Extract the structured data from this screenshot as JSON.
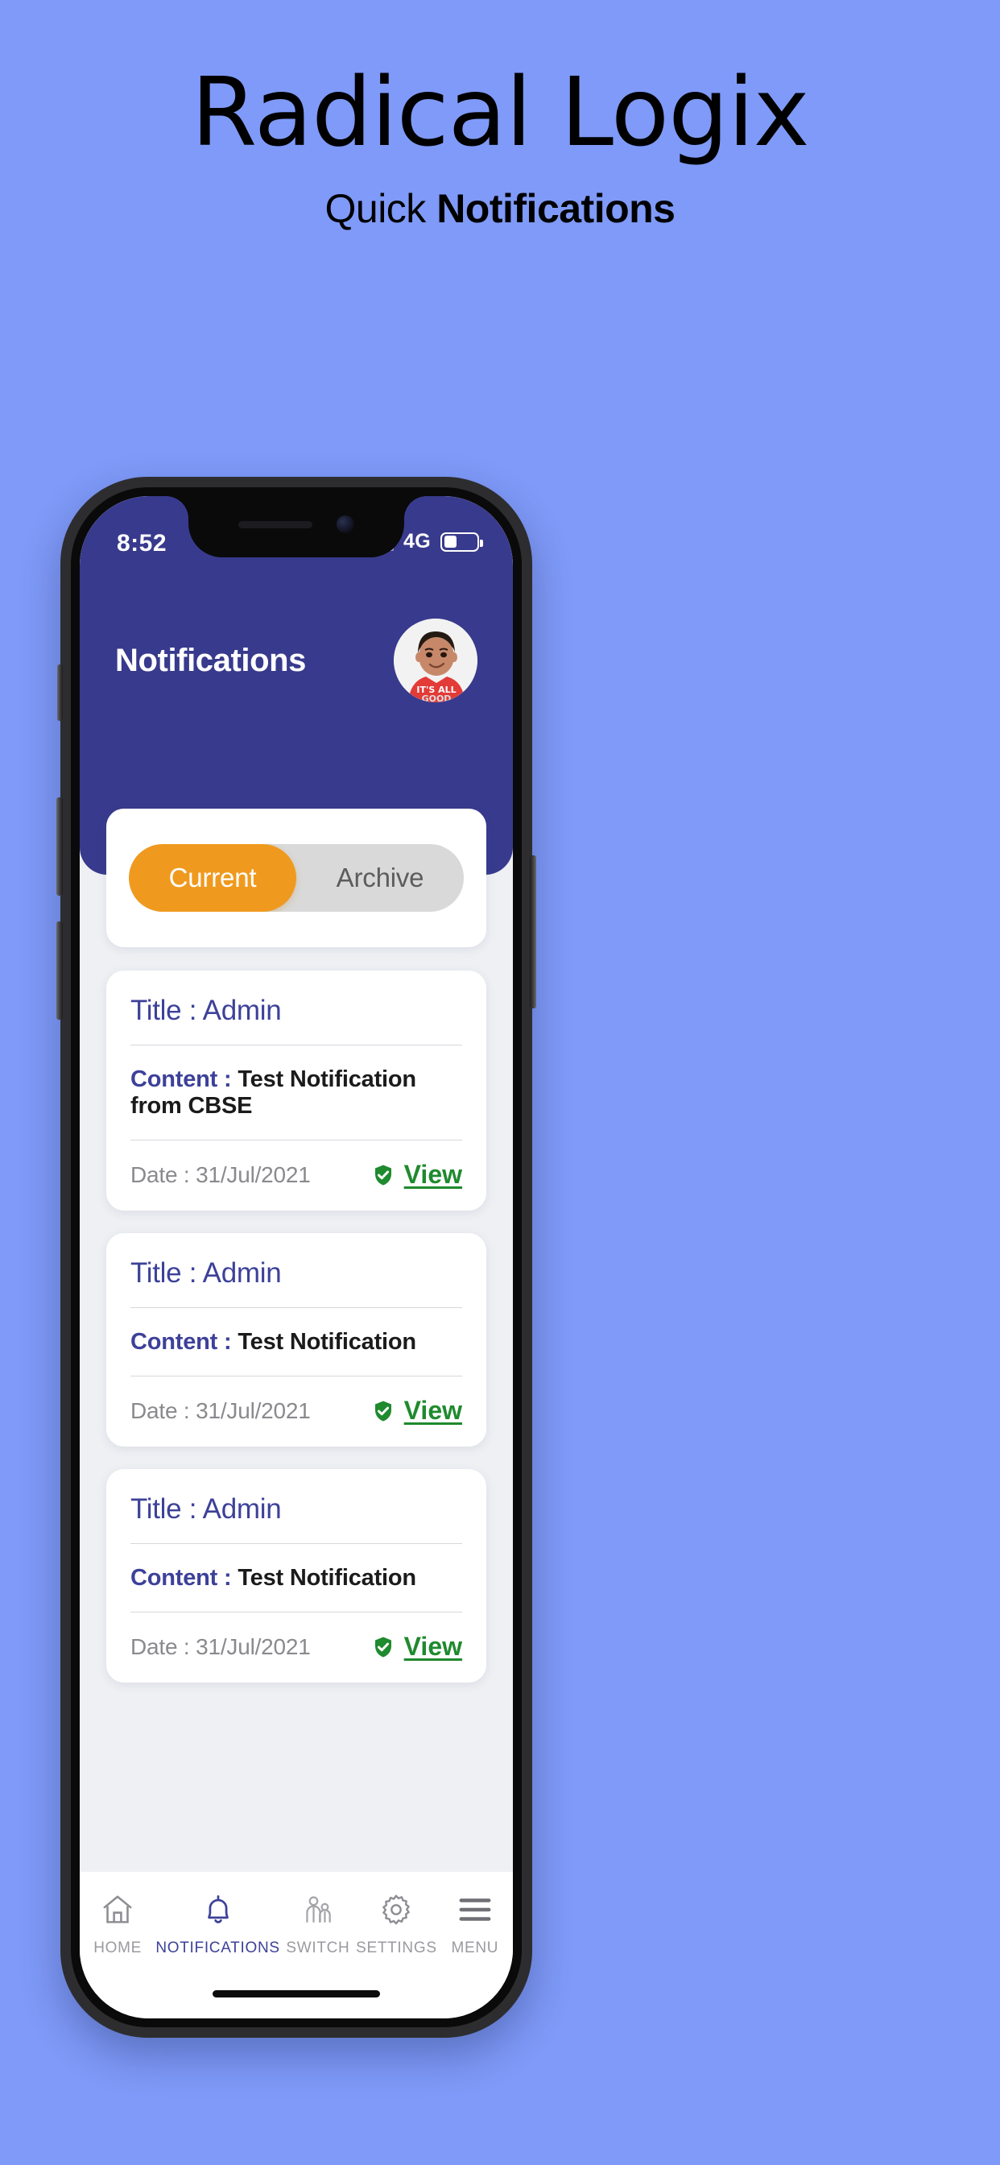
{
  "promo": {
    "title": "Radical Logix",
    "subtitle_regular": "Quick ",
    "subtitle_bold": "Notifications"
  },
  "colors": {
    "page_background": "#7f9af8",
    "header_indigo": "#383a8d",
    "accent_orange": "#ef9a1f",
    "tab_inactive_gray": "#d9d9d9",
    "link_green": "#1f8a2e",
    "title_blue": "#3d4199",
    "screen_background": "#eef0f4"
  },
  "status_bar": {
    "time": "8:52",
    "network": "4G",
    "signal_bars_filled": 2,
    "signal_bars_total": 4,
    "battery_percent": 40,
    "signal_icon": "signal-bars-icon",
    "battery_icon": "battery-icon"
  },
  "app_header": {
    "title": "Notifications",
    "avatar_icon": "user-avatar"
  },
  "tabs": [
    {
      "label": "Current",
      "active": true
    },
    {
      "label": "Archive",
      "active": false
    }
  ],
  "notifications": [
    {
      "title": "Title : Admin",
      "content_label": "Content : ",
      "content_value": "Test Notification from CBSE",
      "date": "Date : 31/Jul/2021",
      "action_label": "View",
      "action_icon": "shield-check-icon"
    },
    {
      "title": "Title : Admin",
      "content_label": "Content : ",
      "content_value": "Test Notification",
      "date": "Date : 31/Jul/2021",
      "action_label": "View",
      "action_icon": "shield-check-icon"
    },
    {
      "title": "Title : Admin",
      "content_label": "Content : ",
      "content_value": "Test Notification",
      "date": "Date : 31/Jul/2021",
      "action_label": "View",
      "action_icon": "shield-check-icon"
    }
  ],
  "bottom_nav": [
    {
      "label": "HOME",
      "icon": "home-icon",
      "active": false
    },
    {
      "label": "NOTIFICATIONS",
      "icon": "bell-icon",
      "active": true
    },
    {
      "label": "SWITCH",
      "icon": "people-icon",
      "active": false
    },
    {
      "label": "SETTINGS",
      "icon": "gear-icon",
      "active": false
    },
    {
      "label": "MENU",
      "icon": "hamburger-icon",
      "active": false
    }
  ]
}
